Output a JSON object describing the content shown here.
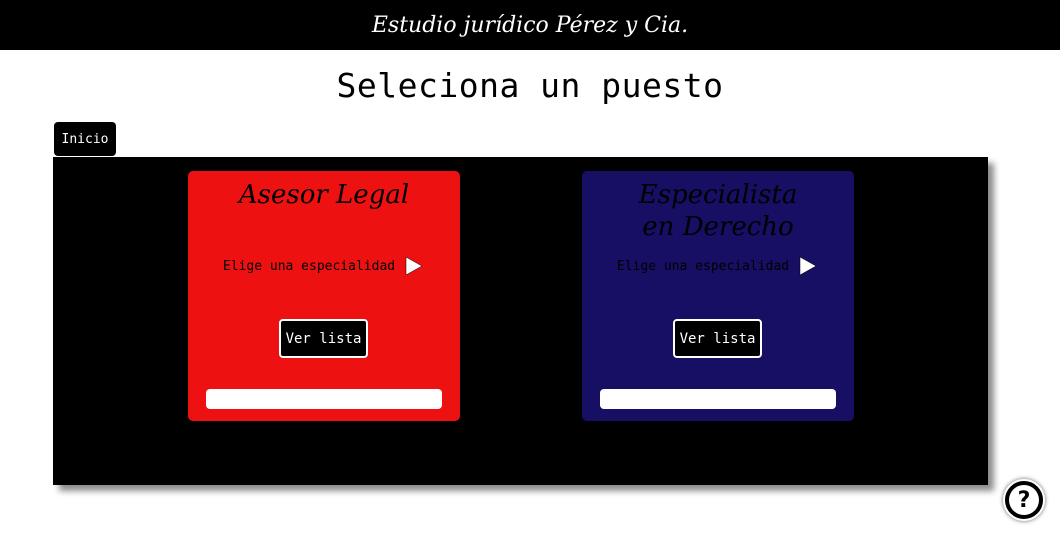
{
  "header": {
    "title": "Estudio jurídico Pérez y Cia."
  },
  "page_title": "Seleciona un puesto",
  "nav": {
    "home_label": "Inicio"
  },
  "cards": [
    {
      "title": "Asesor Legal",
      "subtitle": "Elige una especialidad",
      "button_label": "Ver lista",
      "background": "#ee1111",
      "text_color": "#000000"
    },
    {
      "title": "Especialista en Derecho",
      "subtitle": "Elige una especialidad",
      "button_label": "Ver lista",
      "background": "#170f63",
      "text_color": "#000000"
    }
  ],
  "help": {
    "icon": "question-mark-icon",
    "label": "?"
  },
  "colors": {
    "header_bg": "#000000",
    "stage_bg": "#000000",
    "card_red": "#ee1111",
    "card_navy": "#170f63"
  }
}
